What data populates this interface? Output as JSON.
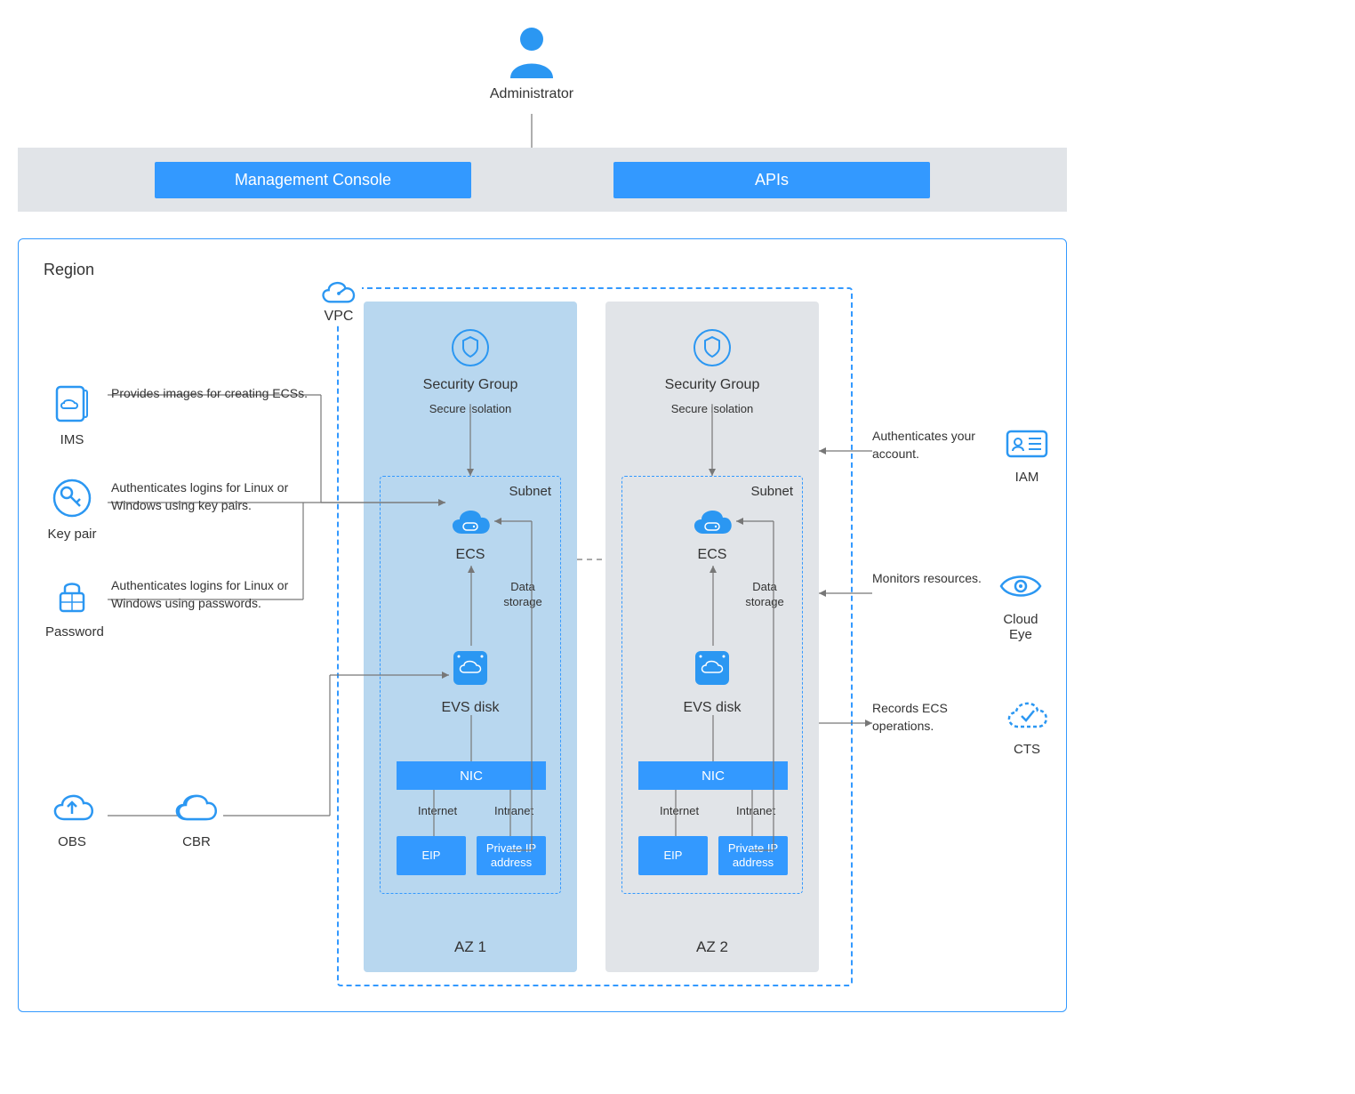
{
  "administrator": {
    "label": "Administrator"
  },
  "access": {
    "management_console": "Management Console",
    "apis": "APIs"
  },
  "region": {
    "label": "Region"
  },
  "vpc": {
    "label": "VPC"
  },
  "az": {
    "security_group": "Security Group",
    "secure_isolation": "Secure isolation",
    "subnet": "Subnet",
    "ecs": "ECS",
    "data_storage": "Data storage",
    "evs_disk": "EVS disk",
    "nic": "NIC",
    "internet": "Internet",
    "intranet": "Intranet",
    "eip": "EIP",
    "private_ip": "Private IP address",
    "az1": "AZ 1",
    "az2": "AZ 2"
  },
  "left_services": {
    "ims": {
      "label": "IMS",
      "desc": "Provides images for creating ECSs."
    },
    "key_pair": {
      "label": "Key pair",
      "desc": "Authenticates logins for Linux or Windows using key pairs."
    },
    "password": {
      "label": "Password",
      "desc": "Authenticates logins for Linux or Windows using passwords."
    },
    "obs": {
      "label": "OBS"
    },
    "cbr": {
      "label": "CBR"
    }
  },
  "right_services": {
    "iam": {
      "label": "IAM",
      "desc": "Authenticates your account."
    },
    "cloud_eye": {
      "label": "Cloud Eye",
      "desc": "Monitors resources."
    },
    "cts": {
      "label": "CTS",
      "desc": "Records ECS operations."
    }
  }
}
